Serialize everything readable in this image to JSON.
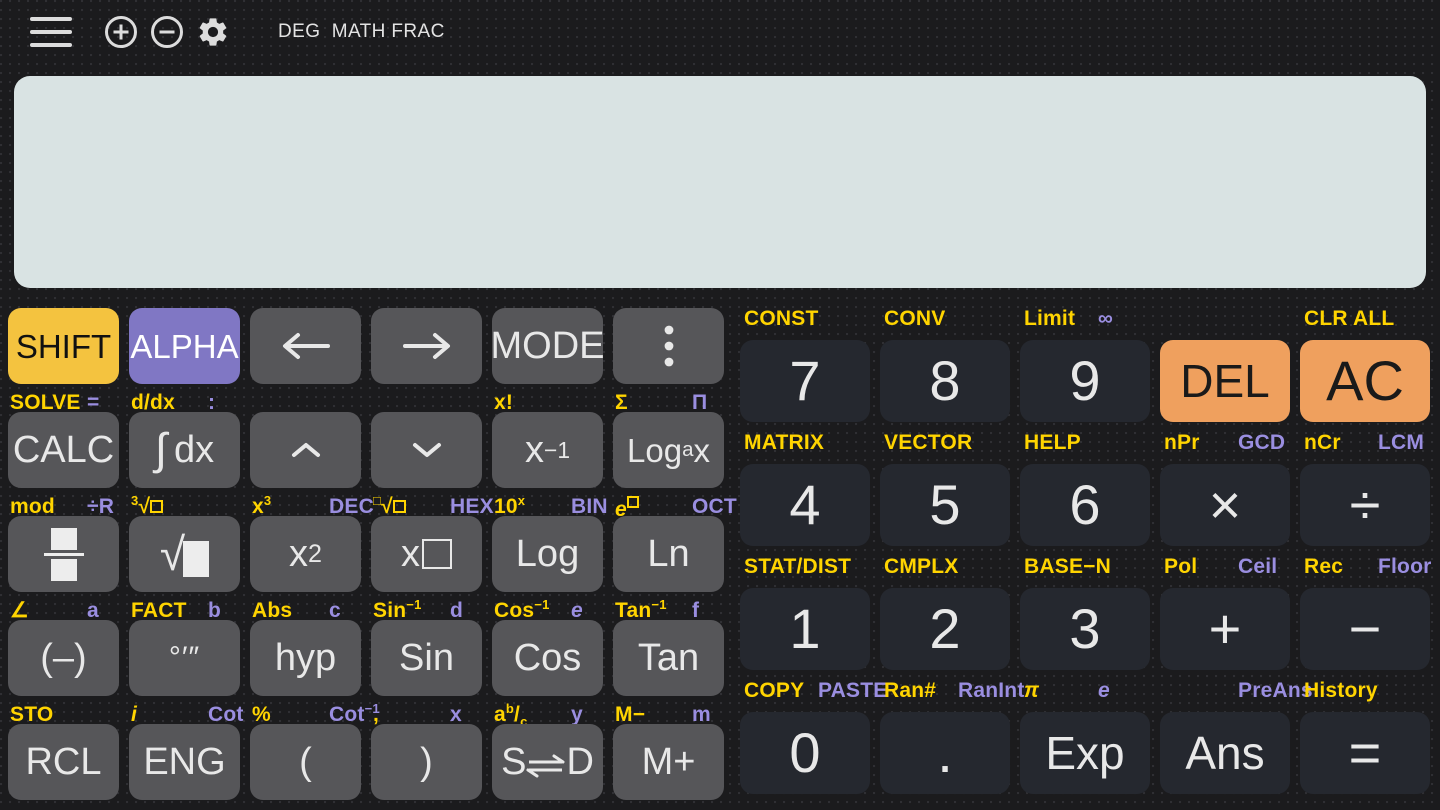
{
  "app": {
    "title": "Scientific Calculator",
    "accent_yellow": "#ffd400",
    "accent_purple": "#9a8ee0",
    "key_fn_bg": "#565659",
    "key_num_bg": "#25282f",
    "shift_bg": "#f4c33f",
    "alpha_bg": "#8077c4",
    "orange_bg": "#efa05e",
    "display_bg": "#d9e3e3",
    "chassis_bg": "#1b1b1d"
  },
  "topbar": {
    "menu_icon": "hamburger-menu-icon",
    "zoom_in_icon": "plus-circle-icon",
    "zoom_out_icon": "minus-circle-icon",
    "settings_icon": "gear-icon",
    "status": "DEG  MATH FRAC",
    "status_parts": [
      "DEG",
      "MATH",
      "FRAC"
    ]
  },
  "display": {
    "value": "",
    "placeholder": ""
  },
  "left_keypad": {
    "rows": [
      {
        "top_labels": [],
        "keys": [
          {
            "label": "SHIFT",
            "style": "shift"
          },
          {
            "label": "ALPHA",
            "style": "alpha"
          },
          {
            "label": "←",
            "style": "fn",
            "name": "arrow-left"
          },
          {
            "label": "→",
            "style": "fn",
            "name": "arrow-right"
          },
          {
            "label": "MODE",
            "style": "fn"
          },
          {
            "label": "⋮",
            "style": "fn",
            "name": "more-menu"
          }
        ],
        "bottom_labels": [
          {
            "left": "SOLVE",
            "right": "="
          },
          {
            "left": "d/dx",
            "right": ":"
          },
          {
            "left": "",
            "right": ""
          },
          {
            "left": "",
            "right": ""
          },
          {
            "left": "x!",
            "right": ""
          },
          {
            "left": "Σ",
            "right": "Π"
          }
        ]
      },
      {
        "keys": [
          {
            "label": "CALC",
            "style": "fn"
          },
          {
            "label": "∫ dx",
            "style": "fn",
            "name": "integral"
          },
          {
            "label": "⌃",
            "style": "fn",
            "name": "arrow-up"
          },
          {
            "label": "⌄",
            "style": "fn",
            "name": "arrow-down"
          },
          {
            "label": "x⁻¹",
            "style": "fn",
            "name": "reciprocal"
          },
          {
            "label": "Log_a x",
            "style": "fn",
            "name": "log-base-a"
          }
        ],
        "bottom_labels": [
          {
            "left": "mod",
            "right": "÷R"
          },
          {
            "left": "³√□",
            "right": ""
          },
          {
            "left": "x³",
            "right": "DEC"
          },
          {
            "left": "□√□",
            "right": "HEX"
          },
          {
            "left": "10ˣ",
            "right": "BIN"
          },
          {
            "left": "e□",
            "right": "OCT"
          }
        ]
      },
      {
        "keys": [
          {
            "label": "fraction",
            "style": "fn",
            "name": "fraction"
          },
          {
            "label": "√□",
            "style": "fn",
            "name": "square-root"
          },
          {
            "label": "x²",
            "style": "fn",
            "name": "square"
          },
          {
            "label": "x□",
            "style": "fn",
            "name": "power"
          },
          {
            "label": "Log",
            "style": "fn"
          },
          {
            "label": "Ln",
            "style": "fn"
          }
        ],
        "bottom_labels": [
          {
            "left": "∠",
            "right": "a"
          },
          {
            "left": "FACT",
            "right": "b"
          },
          {
            "left": "Abs",
            "right": "c"
          },
          {
            "left": "Sin⁻¹",
            "right": "d"
          },
          {
            "left": "Cos⁻¹",
            "right": "e"
          },
          {
            "left": "Tan⁻¹",
            "right": "f"
          }
        ]
      },
      {
        "keys": [
          {
            "label": "(–)",
            "style": "fn",
            "name": "negative"
          },
          {
            "label": "°'''",
            "style": "fn",
            "name": "degree-minute-second"
          },
          {
            "label": "hyp",
            "style": "fn"
          },
          {
            "label": "Sin",
            "style": "fn"
          },
          {
            "label": "Cos",
            "style": "fn"
          },
          {
            "label": "Tan",
            "style": "fn"
          }
        ],
        "bottom_labels": [
          {
            "left": "STO",
            "right": ""
          },
          {
            "left": "i",
            "right": "Cot"
          },
          {
            "left": "%",
            "right": "Cot⁻¹"
          },
          {
            "left": ",",
            "right": "x"
          },
          {
            "left": "aᵇ/c",
            "right": "y"
          },
          {
            "left": "M−",
            "right": "m"
          }
        ]
      },
      {
        "keys": [
          {
            "label": "RCL",
            "style": "fn"
          },
          {
            "label": "ENG",
            "style": "fn"
          },
          {
            "label": "(",
            "style": "fn",
            "name": "paren-open"
          },
          {
            "label": ")",
            "style": "fn",
            "name": "paren-close"
          },
          {
            "label": "S⇄D",
            "style": "fn",
            "name": "standard-decimal-toggle"
          },
          {
            "label": "M+",
            "style": "fn",
            "name": "memory-plus"
          }
        ],
        "bottom_labels": []
      }
    ]
  },
  "right_keypad": {
    "rows": [
      {
        "top_labels": [
          {
            "left": "CONST",
            "right": ""
          },
          {
            "left": "CONV",
            "right": ""
          },
          {
            "left": "Limit",
            "right": "∞"
          },
          {
            "left": "",
            "right": ""
          },
          {
            "left": "CLR ALL",
            "right": ""
          }
        ],
        "keys": [
          {
            "label": "7",
            "style": "num"
          },
          {
            "label": "8",
            "style": "num"
          },
          {
            "label": "9",
            "style": "num"
          },
          {
            "label": "DEL",
            "style": "orange"
          },
          {
            "label": "AC",
            "style": "orange"
          }
        ]
      },
      {
        "top_labels": [
          {
            "left": "MATRIX",
            "right": ""
          },
          {
            "left": "VECTOR",
            "right": ""
          },
          {
            "left": "HELP",
            "right": ""
          },
          {
            "left": "nPr",
            "right": "GCD"
          },
          {
            "left": "nCr",
            "right": "LCM"
          }
        ],
        "keys": [
          {
            "label": "4",
            "style": "num"
          },
          {
            "label": "5",
            "style": "num"
          },
          {
            "label": "6",
            "style": "num"
          },
          {
            "label": "×",
            "style": "num",
            "name": "multiply"
          },
          {
            "label": "÷",
            "style": "num",
            "name": "divide"
          }
        ]
      },
      {
        "top_labels": [
          {
            "left": "STAT/DIST",
            "right": ""
          },
          {
            "left": "CMPLX",
            "right": ""
          },
          {
            "left": "BASE−N",
            "right": ""
          },
          {
            "left": "Pol",
            "right": "Ceil"
          },
          {
            "left": "Rec",
            "right": "Floor"
          }
        ],
        "keys": [
          {
            "label": "1",
            "style": "num"
          },
          {
            "label": "2",
            "style": "num"
          },
          {
            "label": "3",
            "style": "num"
          },
          {
            "label": "+",
            "style": "num",
            "name": "plus"
          },
          {
            "label": "−",
            "style": "num",
            "name": "minus"
          }
        ]
      },
      {
        "top_labels": [
          {
            "left": "COPY",
            "right": "PASTE"
          },
          {
            "left": "Ran#",
            "right": "RanInt"
          },
          {
            "left": "π",
            "right": "e"
          },
          {
            "left": "",
            "right": "PreAns"
          },
          {
            "left": "History",
            "right": ""
          }
        ],
        "keys": [
          {
            "label": "0",
            "style": "num"
          },
          {
            "label": ".",
            "style": "num",
            "name": "decimal-point"
          },
          {
            "label": "Exp",
            "style": "num"
          },
          {
            "label": "Ans",
            "style": "num"
          },
          {
            "label": "=",
            "style": "num",
            "name": "equals"
          }
        ]
      }
    ]
  }
}
